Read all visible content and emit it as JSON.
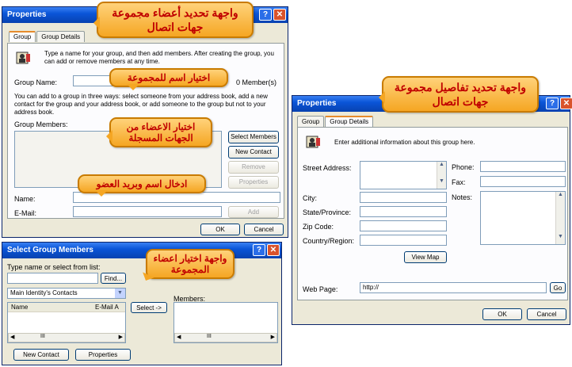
{
  "win1": {
    "title": "Properties",
    "tabs": [
      "Group",
      "Group Details"
    ],
    "intro": "Type a name for your group, and then add members. After creating the group, you can add or remove members at any time.",
    "group_name_label": "Group Name:",
    "member_count": "0 Member(s)",
    "instructions": "You can add to a group in three ways: select someone from your address book, add a new contact for the group and your address book, or add someone to the group but not to your address book.",
    "members_label": "Group Members:",
    "buttons": {
      "select_members": "Select Members",
      "new_contact": "New Contact",
      "remove": "Remove",
      "properties": "Properties",
      "add": "Add",
      "ok": "OK",
      "cancel": "Cancel"
    },
    "name_label": "Name:",
    "email_label": "E-Mail:"
  },
  "win2": {
    "title": "Properties",
    "tabs": [
      "Group",
      "Group Details"
    ],
    "intro": "Enter additional information about this group here.",
    "street_label": "Street Address:",
    "city_label": "City:",
    "state_label": "State/Province:",
    "zip_label": "Zip Code:",
    "country_label": "Country/Region:",
    "phone_label": "Phone:",
    "fax_label": "Fax:",
    "notes_label": "Notes:",
    "view_map": "View Map",
    "web_label": "Web Page:",
    "web_value": "http://",
    "go": "Go",
    "ok": "OK",
    "cancel": "Cancel"
  },
  "win3": {
    "title": "Select Group Members",
    "type_label": "Type name or select from list:",
    "find": "Find...",
    "source": "Main Identity's Contacts",
    "col_name": "Name",
    "col_email": "E-Mail A",
    "select_btn": "Select ->",
    "members_label": "Members:",
    "new_contact": "New Contact",
    "properties": "Properties"
  },
  "callouts": {
    "c1": "واجهة تحديد أعضاء مجموعة جهات اتصال",
    "c2": "اختيار اسم للمجموعة",
    "c3": "اختيار الاعضاء من الجهات المسجلة",
    "c4": "ادخال اسم وبريد العضو",
    "c5": "واجهة اختيار اعضاء المجموعة",
    "c6": "واجهة تحديد تفاصيل مجموعة جهات اتصال"
  }
}
